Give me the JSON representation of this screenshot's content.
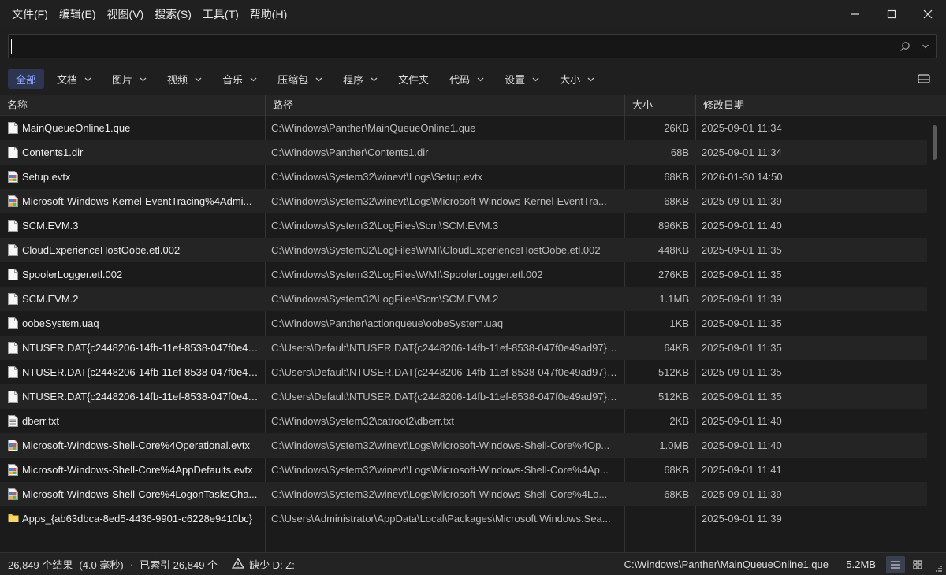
{
  "menu": [
    "文件(F)",
    "编辑(E)",
    "视图(V)",
    "搜索(S)",
    "工具(T)",
    "帮助(H)"
  ],
  "search": {
    "value": "",
    "placeholder": ""
  },
  "filters": [
    {
      "label": "全部",
      "active": true,
      "dropdown": false
    },
    {
      "label": "文档",
      "active": false,
      "dropdown": true
    },
    {
      "label": "图片",
      "active": false,
      "dropdown": true
    },
    {
      "label": "视频",
      "active": false,
      "dropdown": true
    },
    {
      "label": "音乐",
      "active": false,
      "dropdown": true
    },
    {
      "label": "压缩包",
      "active": false,
      "dropdown": true
    },
    {
      "label": "程序",
      "active": false,
      "dropdown": true
    },
    {
      "label": "文件夹",
      "active": false,
      "dropdown": false
    },
    {
      "label": "代码",
      "active": false,
      "dropdown": true
    },
    {
      "label": "设置",
      "active": false,
      "dropdown": true
    },
    {
      "label": "大小",
      "active": false,
      "dropdown": true
    }
  ],
  "columns": {
    "name": "名称",
    "path": "路径",
    "size": "大小",
    "date": "修改日期"
  },
  "rows": [
    {
      "icon": "file",
      "name": "MainQueueOnline1.que",
      "path": "C:\\Windows\\Panther\\MainQueueOnline1.que",
      "size": "26KB",
      "date": "2025-09-01 11:34"
    },
    {
      "icon": "file",
      "name": "Contents1.dir",
      "path": "C:\\Windows\\Panther\\Contents1.dir",
      "size": "68B",
      "date": "2025-09-01 11:34"
    },
    {
      "icon": "evtx",
      "name": "Setup.evtx",
      "path": "C:\\Windows\\System32\\winevt\\Logs\\Setup.evtx",
      "size": "68KB",
      "date": "2026-01-30 14:50"
    },
    {
      "icon": "evtx",
      "name": "Microsoft-Windows-Kernel-EventTracing%4Admi...",
      "path": "C:\\Windows\\System32\\winevt\\Logs\\Microsoft-Windows-Kernel-EventTra...",
      "size": "68KB",
      "date": "2025-09-01 11:39"
    },
    {
      "icon": "file",
      "name": "SCM.EVM.3",
      "path": "C:\\Windows\\System32\\LogFiles\\Scm\\SCM.EVM.3",
      "size": "896KB",
      "date": "2025-09-01 11:40"
    },
    {
      "icon": "file",
      "name": "CloudExperienceHostOobe.etl.002",
      "path": "C:\\Windows\\System32\\LogFiles\\WMI\\CloudExperienceHostOobe.etl.002",
      "size": "448KB",
      "date": "2025-09-01 11:35"
    },
    {
      "icon": "file",
      "name": "SpoolerLogger.etl.002",
      "path": "C:\\Windows\\System32\\LogFiles\\WMI\\SpoolerLogger.etl.002",
      "size": "276KB",
      "date": "2025-09-01 11:35"
    },
    {
      "icon": "file",
      "name": "SCM.EVM.2",
      "path": "C:\\Windows\\System32\\LogFiles\\Scm\\SCM.EVM.2",
      "size": "1.1MB",
      "date": "2025-09-01 11:39"
    },
    {
      "icon": "file",
      "name": "oobeSystem.uaq",
      "path": "C:\\Windows\\Panther\\actionqueue\\oobeSystem.uaq",
      "size": "1KB",
      "date": "2025-09-01 11:35"
    },
    {
      "icon": "file",
      "name": "NTUSER.DAT{c2448206-14fb-11ef-8538-047f0e49...",
      "path": "C:\\Users\\Default\\NTUSER.DAT{c2448206-14fb-11ef-8538-047f0e49ad97}.T...",
      "size": "64KB",
      "date": "2025-09-01 11:35"
    },
    {
      "icon": "file",
      "name": "NTUSER.DAT{c2448206-14fb-11ef-8538-047f0e49...",
      "path": "C:\\Users\\Default\\NTUSER.DAT{c2448206-14fb-11ef-8538-047f0e49ad97}.T...",
      "size": "512KB",
      "date": "2025-09-01 11:35"
    },
    {
      "icon": "file",
      "name": "NTUSER.DAT{c2448206-14fb-11ef-8538-047f0e49...",
      "path": "C:\\Users\\Default\\NTUSER.DAT{c2448206-14fb-11ef-8538-047f0e49ad97}.T...",
      "size": "512KB",
      "date": "2025-09-01 11:35"
    },
    {
      "icon": "text",
      "name": "dberr.txt",
      "path": "C:\\Windows\\System32\\catroot2\\dberr.txt",
      "size": "2KB",
      "date": "2025-09-01 11:40"
    },
    {
      "icon": "evtx",
      "name": "Microsoft-Windows-Shell-Core%4Operational.evtx",
      "path": "C:\\Windows\\System32\\winevt\\Logs\\Microsoft-Windows-Shell-Core%4Op...",
      "size": "1.0MB",
      "date": "2025-09-01 11:40"
    },
    {
      "icon": "evtx",
      "name": "Microsoft-Windows-Shell-Core%4AppDefaults.evtx",
      "path": "C:\\Windows\\System32\\winevt\\Logs\\Microsoft-Windows-Shell-Core%4Ap...",
      "size": "68KB",
      "date": "2025-09-01 11:41"
    },
    {
      "icon": "evtx",
      "name": "Microsoft-Windows-Shell-Core%4LogonTasksCha...",
      "path": "C:\\Windows\\System32\\winevt\\Logs\\Microsoft-Windows-Shell-Core%4Lo...",
      "size": "68KB",
      "date": "2025-09-01 11:39"
    },
    {
      "icon": "folder",
      "name": "Apps_{ab63dbca-8ed5-4436-9901-c6228e9410bc}",
      "path": "C:\\Users\\Administrator\\AppData\\Local\\Packages\\Microsoft.Windows.Sea...",
      "size": "",
      "date": "2025-09-01 11:39"
    }
  ],
  "status": {
    "results": "26,849 个结果",
    "time": "(4.0 毫秒)",
    "indexed": "已索引 26,849 个",
    "missing": "缺少 D: Z:",
    "selected_path": "C:\\Windows\\Panther\\MainQueueOnline1.que",
    "selected_size": "5.2MB"
  },
  "colors": {
    "accent": "#8fa8ff",
    "active_bg": "#2e3550"
  }
}
